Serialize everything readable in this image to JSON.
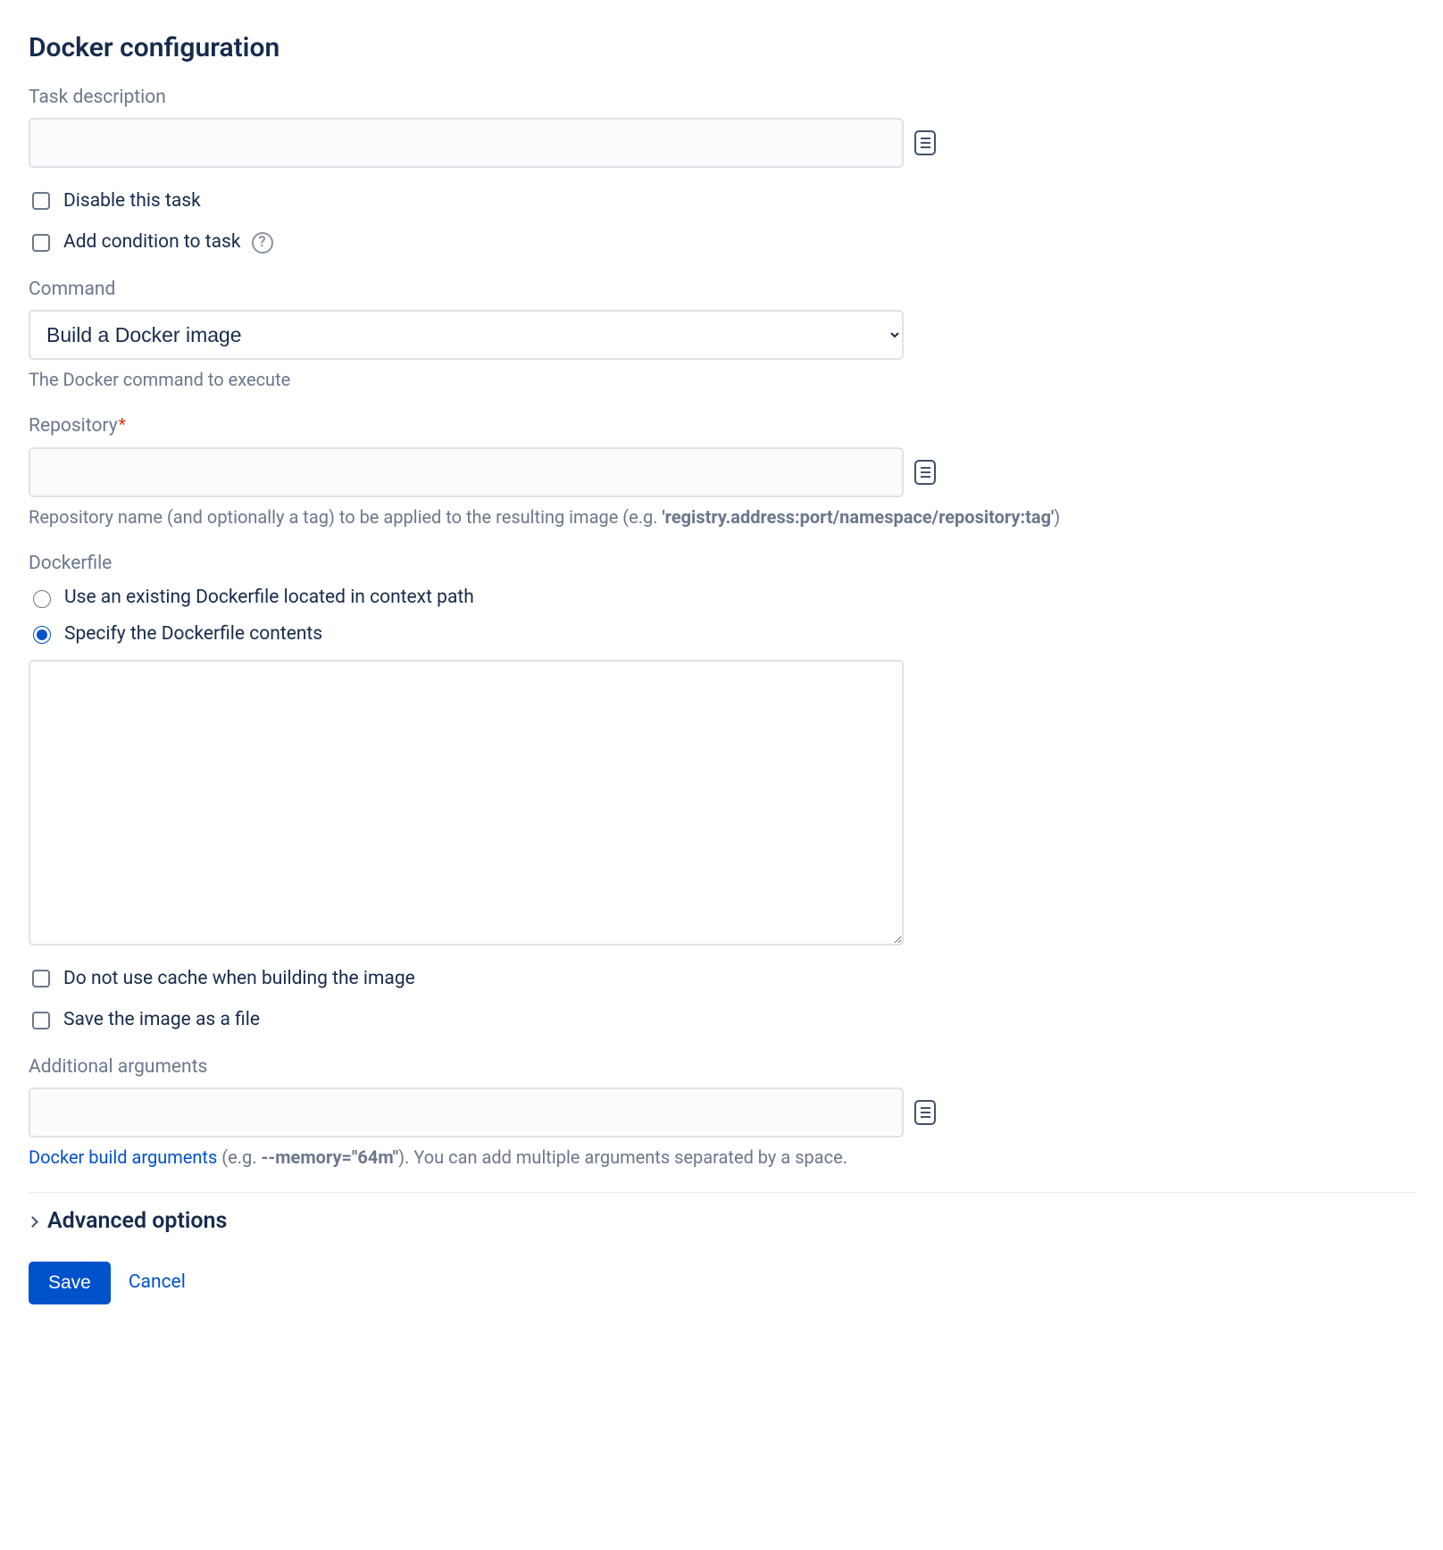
{
  "title": "Docker configuration",
  "taskDescription": {
    "label": "Task description",
    "value": ""
  },
  "disableTask": {
    "label": "Disable this task",
    "checked": false
  },
  "addCondition": {
    "label": "Add condition to task",
    "checked": false
  },
  "command": {
    "label": "Command",
    "selected": "Build a Docker image",
    "helper": "The Docker command to execute"
  },
  "repository": {
    "label": "Repository",
    "required": true,
    "value": "",
    "helperPrefix": "Repository name (and optionally a tag) to be applied to the resulting image (e.g. ",
    "helperCode": "'registry.address:port/namespace/repository:tag'",
    "helperSuffix": ")"
  },
  "dockerfile": {
    "label": "Dockerfile",
    "options": {
      "existing": "Use an existing Dockerfile located in context path",
      "specify": "Specify the Dockerfile contents"
    },
    "selected": "specify",
    "contents": ""
  },
  "noCache": {
    "label": "Do not use cache when building the image",
    "checked": false
  },
  "saveFile": {
    "label": "Save the image as a file",
    "checked": false
  },
  "additionalArgs": {
    "label": "Additional arguments",
    "value": "",
    "helperLink": "Docker build arguments",
    "helperMid": " (e.g. ",
    "helperCode": "--memory=\"64m\"",
    "helperSuffix": "). You can add multiple arguments separated by a space."
  },
  "advanced": "Advanced options",
  "buttons": {
    "save": "Save",
    "cancel": "Cancel"
  }
}
